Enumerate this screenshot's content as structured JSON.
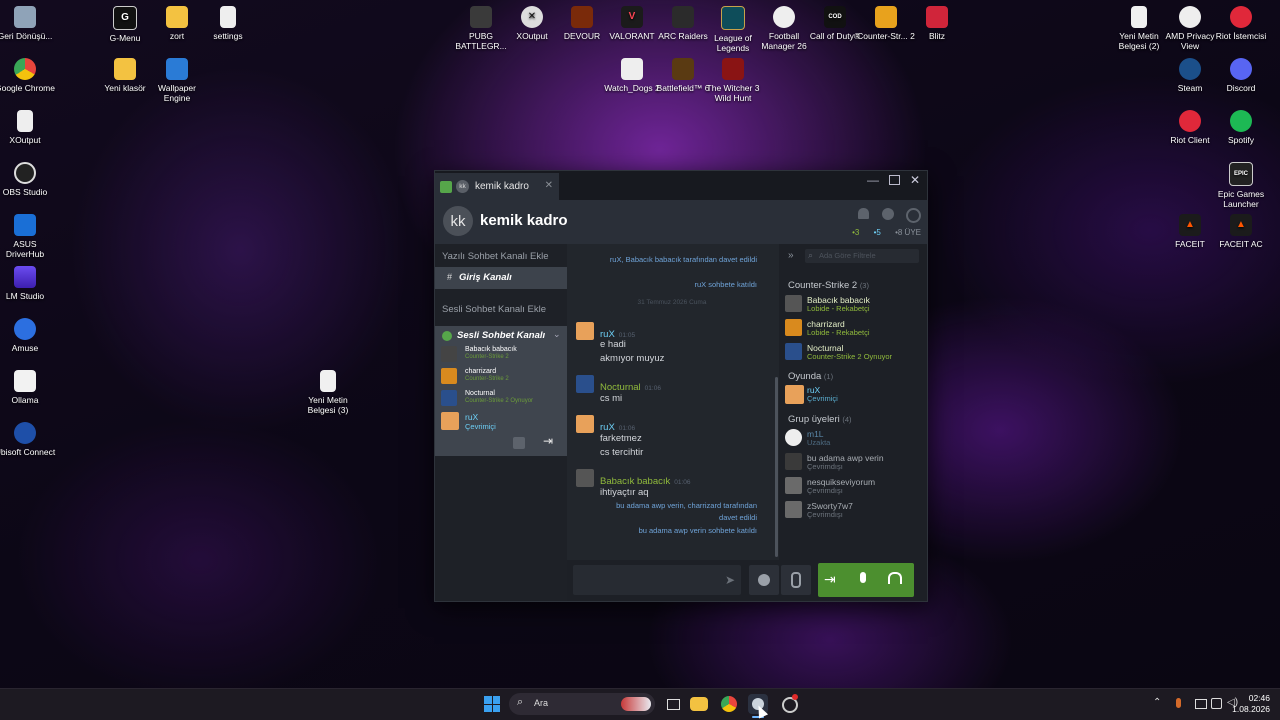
{
  "desktop_icons_left": [
    {
      "label": "Geri Dönüşü..."
    },
    {
      "label": "Google Chrome"
    },
    {
      "label": "XOutput"
    },
    {
      "label": "OBS Studio"
    },
    {
      "label": "ASUS DriverHub"
    },
    {
      "label": "LM Studio"
    },
    {
      "label": "Amuse"
    },
    {
      "label": "Ollama"
    },
    {
      "label": "Ubisoft Connect"
    }
  ],
  "desktop_icons_col2": [
    {
      "label": "G-Menu"
    },
    {
      "label": "Yeni klasör"
    }
  ],
  "desktop_icons_col3": [
    {
      "label": "zort"
    },
    {
      "label": "Wallpaper Engine"
    }
  ],
  "desktop_icon_settings": {
    "label": "settings"
  },
  "desktop_icon_textfile": {
    "label": "Yeni Metin Belgesi (3)"
  },
  "desktop_icons_top": [
    {
      "label": "PUBG BATTLEGR..."
    },
    {
      "label": "XOutput"
    },
    {
      "label": "DEVOUR"
    },
    {
      "label": "VALORANT"
    },
    {
      "label": "ARC Raiders"
    },
    {
      "label": "League of Legends"
    },
    {
      "label": "Football Manager 26"
    },
    {
      "label": "Call of Duty®"
    },
    {
      "label": "Counter-Str... 2"
    },
    {
      "label": "Blitz"
    }
  ],
  "desktop_icons_top2": [
    {
      "label": "Watch_Dogs 2"
    },
    {
      "label": "Battlefield™ 6"
    },
    {
      "label": "The Witcher 3 Wild Hunt"
    }
  ],
  "desktop_icons_right": [
    {
      "label": "Yeni Metin Belgesi (2)"
    },
    {
      "label": "AMD Privacy View"
    },
    {
      "label": "Riot İstemcisi"
    },
    {
      "label": "Steam"
    },
    {
      "label": "Discord"
    },
    {
      "label": "Riot Client"
    },
    {
      "label": "Spotify"
    },
    {
      "label": "Epic Games Launcher"
    },
    {
      "label": "FACEIT"
    },
    {
      "label": "FACEIT AC"
    }
  ],
  "window": {
    "tab_initials": "kk",
    "tab_title": "kemik kadro",
    "group_initials": "kk",
    "group_name": "kemik kadro",
    "counts": {
      "in_game": "3",
      "online": "5",
      "members": "8 ÜYE"
    },
    "left": {
      "text_channel_add": "Yazılı Sohbet Kanalı Ekle",
      "entry_channel": "Giriş Kanalı",
      "voice_channel_add": "Sesli Sohbet Kanalı Ekle",
      "voice_channel": "Sesli Sohbet Kanalı",
      "voice_members": [
        {
          "name": "Babacık babacık",
          "game": "Counter-Strike 2",
          "sub": "Lobide - Rekabetçi"
        },
        {
          "name": "charrizard",
          "game": "Counter-Strike 2",
          "sub": "Lobide - Rekabetçi"
        },
        {
          "name": "Nocturnal",
          "game": "Counter-Strike 2",
          "sub": "Counter-Strike 2 Oynuyor"
        },
        {
          "name": "ruX",
          "game": "Çevrimiçi",
          "sub": ""
        }
      ]
    },
    "chat": {
      "sys1": "ruX, Babacık babacık tarafından davet edildi",
      "sys2": "ruX sohbete katıldı",
      "date_divider": "31 Temmuz 2026 Cuma",
      "messages": [
        {
          "name": "ruX",
          "time": "01:05",
          "lines": [
            "e hadi",
            "akmıyor muyuz"
          ]
        },
        {
          "name": "Nocturnal",
          "time": "01:06",
          "lines": [
            "cs mi"
          ]
        },
        {
          "name": "ruX",
          "time": "01:06",
          "lines": [
            "farketmez",
            "cs tercihtir"
          ]
        },
        {
          "name": "Babacık babacık",
          "time": "01:06",
          "lines": [
            "ihtiyaçtır aq"
          ]
        }
      ],
      "sys3": "bu adama awp verin, charrizard tarafından davet edildi",
      "sys4": "bu adama awp verin sohbete katıldı"
    },
    "members": {
      "search_placeholder": "Ada Göre Filtrele",
      "section_cs": "Counter-Strike 2",
      "section_cs_count": "(3)",
      "cs_members": [
        {
          "name": "Babacık babacık",
          "status": "Lobide - Rekabetçi"
        },
        {
          "name": "charrizard",
          "status": "Lobide - Rekabetçi"
        },
        {
          "name": "Nocturnal",
          "status": "Counter-Strike 2 Oynuyor"
        }
      ],
      "section_online": "Oyunda",
      "section_online_count": "(1)",
      "online_members": [
        {
          "name": "ruX",
          "status": "Çevrimiçi"
        }
      ],
      "section_group": "Grup üyeleri",
      "section_group_count": "(4)",
      "group_members": [
        {
          "name": "m1L",
          "status": "Uzakta"
        },
        {
          "name": "bu adama awp verin",
          "status": "Çevrimdışı"
        },
        {
          "name": "nesquikseviyorum",
          "status": "Çevrimdışı"
        },
        {
          "name": "zSworty7w7",
          "status": "Çevrimdışı"
        }
      ]
    }
  },
  "taskbar": {
    "search_label": "Ara",
    "time": "02:46",
    "date": "1.08.2026"
  },
  "colors": {
    "green": "#90ba3c",
    "blue_name": "#6dcff6",
    "online_text": "#6dcff6",
    "accent_green": "#3f8f3f"
  }
}
